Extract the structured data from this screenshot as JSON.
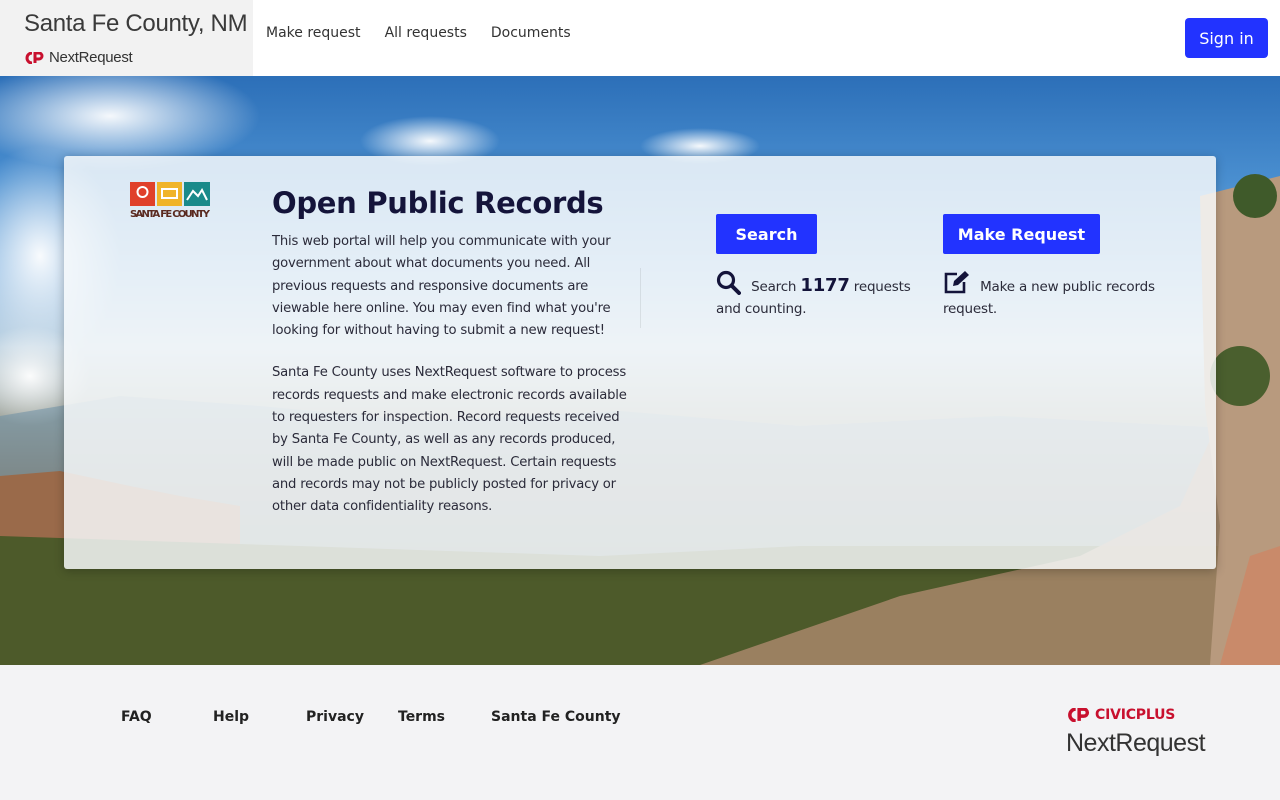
{
  "header": {
    "title": "Santa Fe County, NM",
    "product": "NextRequest",
    "nav": [
      {
        "label": "Make request"
      },
      {
        "label": "All requests"
      },
      {
        "label": "Documents"
      }
    ],
    "sign_in_label": "Sign in"
  },
  "hero": {
    "logo_text": "SANTA FE COUNTY",
    "title": "Open Public Records",
    "intro_p1": "This web portal will help you communicate with your government about what documents you need. All previous requests and responsive documents are viewable here online. You may even find what you're looking for without having to submit a new request!",
    "intro_p2": "Santa Fe County uses NextRequest software to process records requests and make electronic records available to requesters for inspection. Record requests received by Santa Fe County, as well as any records produced, will be made public on NextRequest. Certain requests and records may not be publicly posted for privacy or other data confidentiality reasons.",
    "search": {
      "button_label": "Search",
      "desc_prefix": "Search",
      "count": "1177",
      "desc_suffix": "requests and counting."
    },
    "make_request": {
      "button_label": "Make Request",
      "desc": "Make a new public records request."
    }
  },
  "footer": {
    "links": [
      {
        "label": "FAQ"
      },
      {
        "label": "Help"
      },
      {
        "label": "Privacy"
      },
      {
        "label": "Terms"
      },
      {
        "label": "Santa Fe County"
      }
    ],
    "brand_civic": "CIVICPLUS",
    "brand_product": "NextRequest"
  },
  "colors": {
    "accent": "#2233ff",
    "civic_red": "#c8102e",
    "title_navy": "#14143a"
  },
  "icons": {
    "brand_logo": "civicplus-cp-logo-icon",
    "search": "search-icon",
    "make_request": "edit-icon"
  }
}
